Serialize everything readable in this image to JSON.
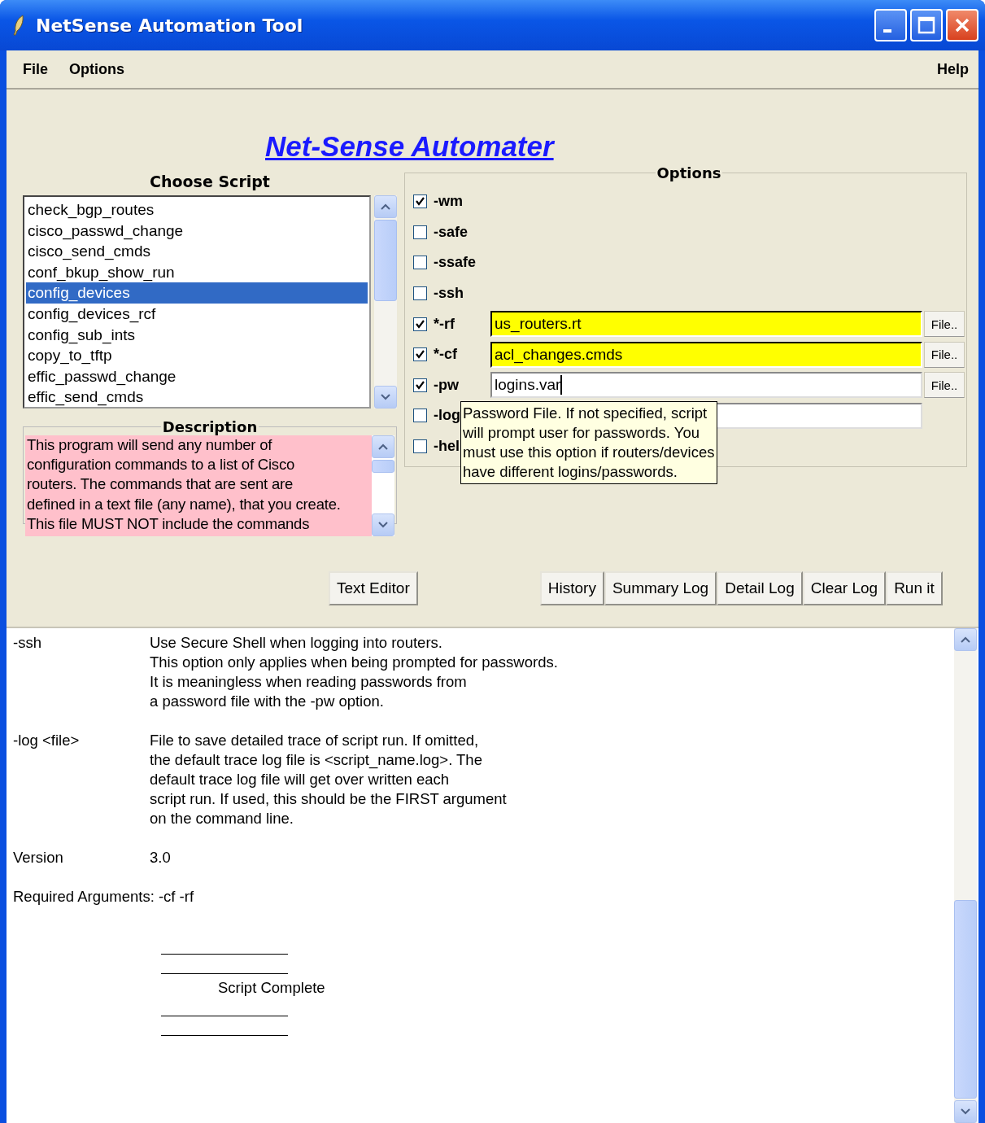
{
  "window": {
    "title": "NetSense Automation Tool"
  },
  "menu": [
    {
      "label": "File"
    },
    {
      "label": "Options"
    },
    {
      "label": "Help"
    }
  ],
  "heading": "Net-Sense Automater",
  "scripts": {
    "label": "Choose Script",
    "items": [
      {
        "label": "check_bgp_routes",
        "selected": false
      },
      {
        "label": "cisco_passwd_change",
        "selected": false
      },
      {
        "label": "cisco_send_cmds",
        "selected": false
      },
      {
        "label": "conf_bkup_show_run",
        "selected": false
      },
      {
        "label": "config_devices",
        "selected": true
      },
      {
        "label": "config_devices_rcf",
        "selected": false
      },
      {
        "label": "config_sub_ints",
        "selected": false
      },
      {
        "label": "copy_to_tftp",
        "selected": false
      },
      {
        "label": "effic_passwd_change",
        "selected": false
      },
      {
        "label": "effic_send_cmds",
        "selected": false
      }
    ]
  },
  "description": {
    "label": "Description",
    "lines": [
      "This program will send any number of",
      "configuration commands to a list of Cisco",
      "routers.  The commands that are sent are",
      "defined in a text file (any name), that you create.",
      "This file MUST NOT include the commands"
    ]
  },
  "options": {
    "label": "Options",
    "rows": [
      {
        "kind": "flag",
        "label": "-wm",
        "checked": true
      },
      {
        "kind": "flag",
        "label": "-safe",
        "checked": false
      },
      {
        "kind": "flag",
        "label": "-ssafe",
        "checked": false
      },
      {
        "kind": "flag",
        "label": "-ssh",
        "checked": false
      },
      {
        "kind": "file",
        "label": "*-rf",
        "checked": true,
        "value": "us_routers.rt",
        "highlighted": true,
        "button": "File.."
      },
      {
        "kind": "file",
        "label": "*-cf",
        "checked": true,
        "value": "acl_changes.cmds",
        "highlighted": true,
        "button": "File.."
      },
      {
        "kind": "file",
        "label": "-pw",
        "checked": true,
        "value": "logins.var",
        "highlighted": false,
        "button": "File.."
      },
      {
        "kind": "field",
        "label": "-log",
        "checked": false,
        "highlighted": false
      },
      {
        "kind": "flag",
        "label": "-hel",
        "checked": false
      }
    ]
  },
  "tooltip": [
    "Password File. If not specified, script",
    "will prompt user for passwords. You",
    "must use this option if routers/devices",
    "have different logins/passwords."
  ],
  "buttons_left": [
    "Text Editor"
  ],
  "buttons_right": [
    "History",
    "Summary Log",
    "Detail Log",
    "Clear Log",
    "Run it"
  ],
  "log": {
    "entries": [
      {
        "term": "-ssh",
        "lines": [
          "Use Secure Shell when logging into routers.",
          "This option only applies when being prompted for passwords.",
          "It is meaningless when reading passwords from",
          "a password file with the -pw option."
        ]
      },
      {
        "term": "-log <file>",
        "lines": [
          "File to save detailed trace of script run.  If omitted,",
          "the default trace log file is <script_name.log>.  The",
          "default trace log file will get over written each",
          "script run.  If used, this should be the FIRST argument",
          "on the command line."
        ]
      },
      {
        "term": "Version",
        "lines": [
          "3.0"
        ]
      }
    ],
    "required": "Required Arguments: -cf -rf",
    "complete": "Script Complete"
  }
}
